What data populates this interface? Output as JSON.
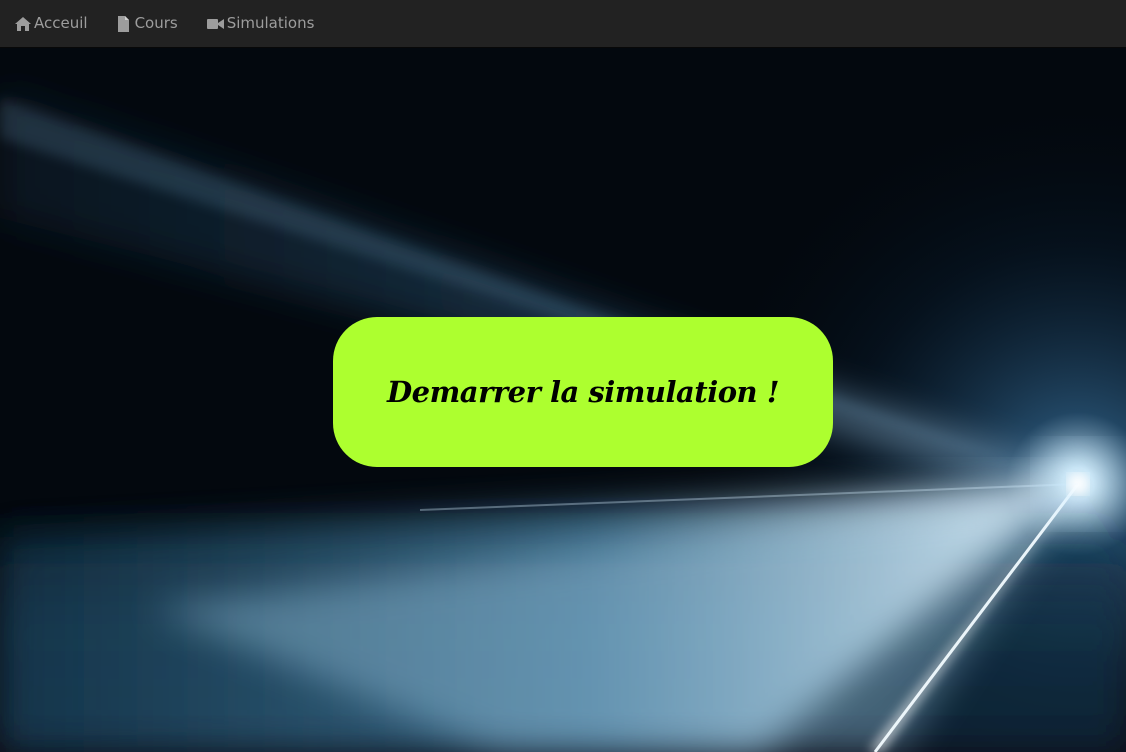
{
  "navbar": {
    "items": [
      {
        "label": "Acceuil",
        "icon": "home-icon"
      },
      {
        "label": "Cours",
        "icon": "file-icon"
      },
      {
        "label": "Simulations",
        "icon": "video-camera-icon"
      }
    ]
  },
  "hero": {
    "background": "laser-beam-fog-photo",
    "start_button_label": "Demarrer la simulation !"
  },
  "colors": {
    "navbar_bg": "#222222",
    "nav_text": "#9d9d9d",
    "button_bg": "#adff2f",
    "button_text": "#000000"
  }
}
